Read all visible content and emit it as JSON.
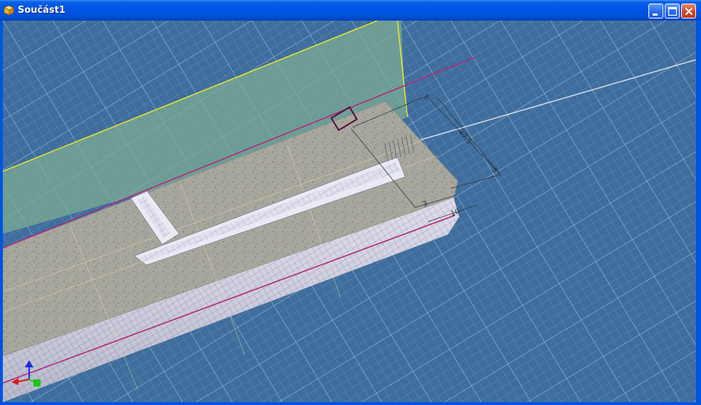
{
  "window": {
    "title": "Součást1",
    "icon": "part-icon",
    "controls": [
      "minimize-icon",
      "maximize-icon",
      "close-icon"
    ]
  },
  "viewport": {
    "dimensions": [
      {
        "name": "dim-5-top",
        "text": "5"
      },
      {
        "name": "dim-47-5",
        "text": "47,5"
      },
      {
        "name": "dim-5-right",
        "text": "5"
      },
      {
        "name": "dim-3",
        "text": "3"
      },
      {
        "name": "dim-10",
        "text": "10"
      }
    ],
    "colors": {
      "background": "#3f6e9e",
      "grid": "#c8dcf0",
      "plane": "#7fae92",
      "plane_edge": "#e8e830",
      "part": "#a4a49c",
      "profile_edge": "#b02a78"
    },
    "triad": {
      "x_color": "#e01818",
      "y_color": "#18c818",
      "z_color": "#1a2ae0"
    }
  }
}
